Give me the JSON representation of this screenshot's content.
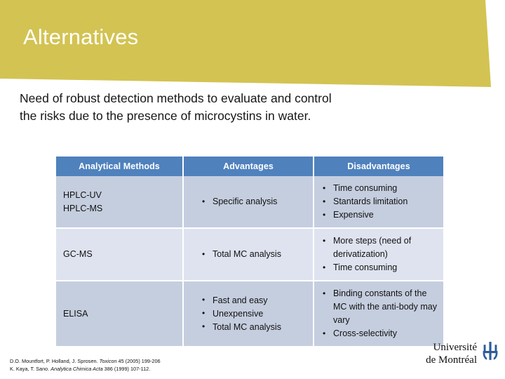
{
  "slide": {
    "title": "Alternatives",
    "intro_line1": "Need of robust detection methods to evaluate and control",
    "intro_line2": "the risks due to the presence of microcystins in water.",
    "banner_color": "#D3C352",
    "header_color": "#4F81BD",
    "row_dark_color": "#C5CEDF",
    "row_light_color": "#DEE3EF"
  },
  "table": {
    "headers": [
      "Analytical Methods",
      "Advantages",
      "Disadvantages"
    ],
    "rows": [
      {
        "method_lines": [
          "HPLC-UV",
          "HPLC-MS"
        ],
        "advantages": [
          "Specific analysis"
        ],
        "disadvantages": [
          "Time consuming",
          "Stantards limitation",
          "Expensive"
        ]
      },
      {
        "method_lines": [
          "GC-MS"
        ],
        "advantages": [
          "Total MC analysis"
        ],
        "disadvantages": [
          "More steps (need of derivatization)",
          "Time consuming"
        ]
      },
      {
        "method_lines": [
          "ELISA"
        ],
        "advantages": [
          "Fast and easy",
          "Unexpensive",
          "Total MC analysis"
        ],
        "disadvantages": [
          "Binding constants of the MC with the anti-body may vary",
          "Cross-selectivity"
        ]
      }
    ]
  },
  "citations": {
    "line1_a": "D.O. Mountfort, P. Holland, J. Sprosen. ",
    "line1_italic": "Toxicon",
    "line1_b": " 45 (2005) 199-206",
    "line2_a": "K. Kaya, T. Sano. ",
    "line2_italic": "Analytica Chimica Acta",
    "line2_b": " 386 (1999) 107-112."
  },
  "logo": {
    "line1": "Université",
    "line2": "de Montréal",
    "mark_color": "#2E5C9A"
  }
}
